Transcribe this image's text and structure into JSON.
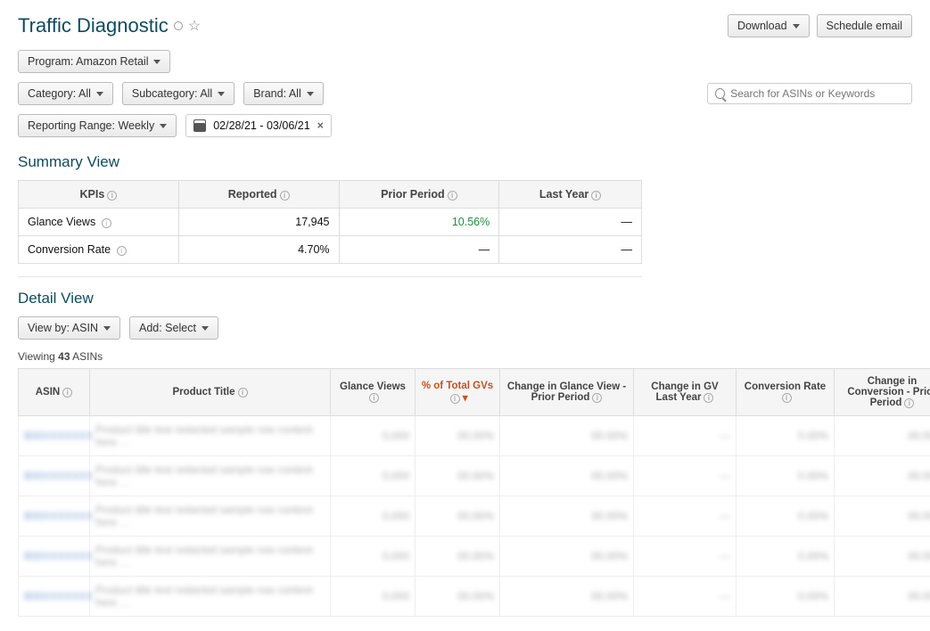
{
  "header": {
    "title": "Traffic Diagnostic",
    "download_label": "Download",
    "schedule_label": "Schedule email"
  },
  "filters": {
    "program": "Program: Amazon Retail",
    "category": "Category: All",
    "subcategory": "Subcategory: All",
    "brand": "Brand: All",
    "reporting_range": "Reporting Range: Weekly",
    "date_range": "02/28/21 - 03/06/21",
    "search_placeholder": "Search for ASINs or Keywords"
  },
  "summary": {
    "title": "Summary View",
    "headers": {
      "kpis": "KPIs",
      "reported": "Reported",
      "prior": "Prior Period",
      "last_year": "Last Year"
    },
    "rows": [
      {
        "label": "Glance Views",
        "reported": "17,945",
        "prior": "10.56%",
        "prior_class": "green",
        "last_year": "—"
      },
      {
        "label": "Conversion Rate",
        "reported": "4.70%",
        "prior": "—",
        "prior_class": "",
        "last_year": "—"
      }
    ]
  },
  "detail": {
    "title": "Detail View",
    "view_by": "View by: ASIN",
    "add_select": "Add: Select",
    "viewing_prefix": "Viewing ",
    "viewing_count": "43",
    "viewing_suffix": " ASINs",
    "headers": {
      "asin": "ASIN",
      "product_title": "Product Title",
      "glance_views": "Glance Views",
      "pct_total_gvs": "% of Total GVs",
      "chg_gv_prior": "Change in Glance View - Prior Period",
      "chg_gv_ly": "Change in GV Last Year",
      "conversion": "Conversion Rate",
      "chg_conv_prior": "Change in Conversion - Prior Period"
    }
  }
}
